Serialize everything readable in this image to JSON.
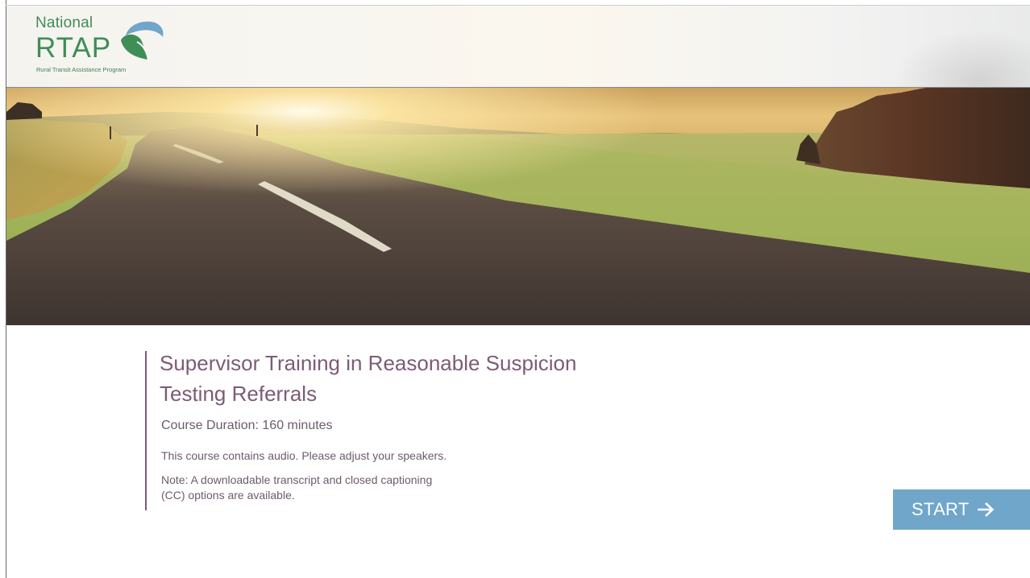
{
  "header": {
    "logo": {
      "line1": "National",
      "line2": "RTAP",
      "tagline": "Rural Transit Assistance Program",
      "colors": {
        "green": "#3f8d57",
        "blue": "#6fa6c9"
      }
    }
  },
  "hero": {
    "image": "rural-road-sunrise-photo"
  },
  "course": {
    "title": "Supervisor Training in Reasonable Suspicion Testing Referrals",
    "duration": "Course Duration: 160 minutes",
    "audio_note": "This course contains audio. Please adjust your speakers.",
    "transcript_note": "Note: A downloadable transcript and closed captioning (CC) options are available."
  },
  "actions": {
    "start_label": "START",
    "start_icon": "arrow-right-icon"
  },
  "colors": {
    "accent": "#7d5b78",
    "body_text": "#6e5a6d",
    "button": "#6fa6c9"
  }
}
